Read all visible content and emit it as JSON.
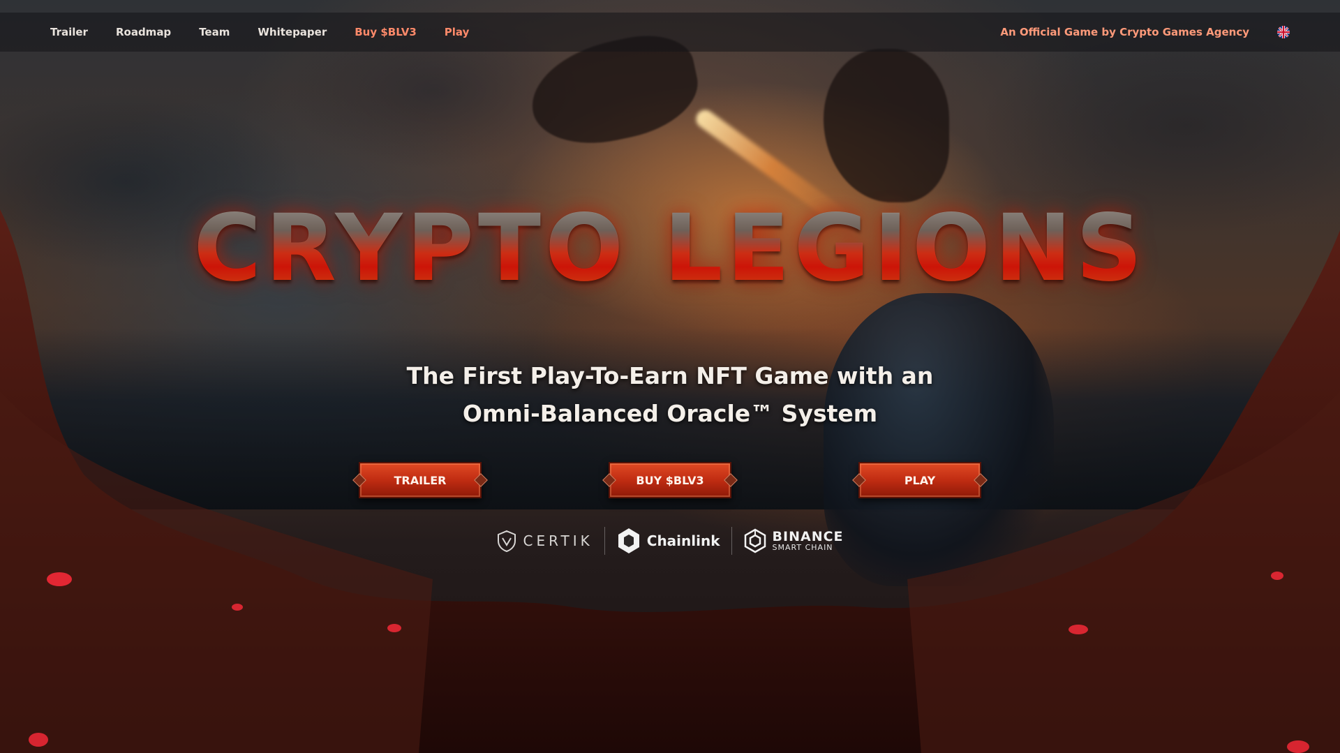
{
  "nav": {
    "links": [
      {
        "label": "Trailer"
      },
      {
        "label": "Roadmap"
      },
      {
        "label": "Team"
      },
      {
        "label": "Whitepaper"
      },
      {
        "label": "Buy $BLV3"
      },
      {
        "label": "Play"
      }
    ],
    "agency": "An Official Game by Crypto Games Agency",
    "language_icon": "uk-flag-icon"
  },
  "hero": {
    "title": "CRYPTO LEGIONS",
    "subtitle_line1": "The First Play-To-Earn NFT Game with an",
    "subtitle_line2": "Omni-Balanced Oracle™ System",
    "buttons": [
      {
        "label": "TRAILER"
      },
      {
        "label": "BUY $BLV3"
      },
      {
        "label": "PLAY"
      }
    ]
  },
  "partners": {
    "certik": "CERTIK",
    "chainlink": "Chainlink",
    "binance": "BINANCE",
    "binance_sub": "SMART CHAIN"
  },
  "colors": {
    "accent": "#ff8a6a",
    "button": "#c02c12",
    "title_red": "#ff1a0a"
  }
}
